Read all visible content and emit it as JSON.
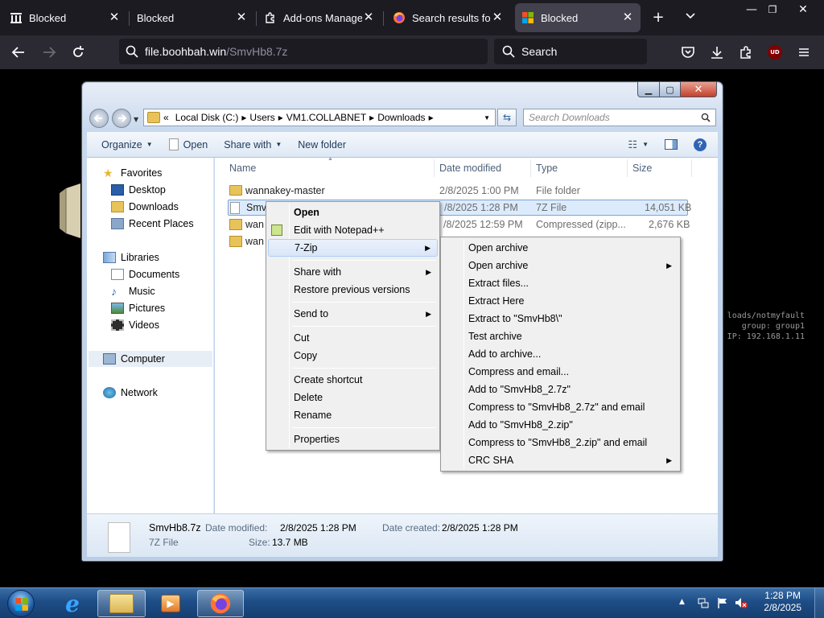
{
  "browser": {
    "tabs": [
      {
        "label": "Blocked",
        "icon": "pillar-icon",
        "active": false
      },
      {
        "label": "Blocked",
        "icon": "none",
        "active": false
      },
      {
        "label": "Add-ons Manager",
        "icon": "puzzle-icon",
        "active": false
      },
      {
        "label": "Search results for '",
        "icon": "firefox-icon",
        "active": false
      },
      {
        "label": "Blocked",
        "icon": "windows-logo-icon",
        "active": true
      }
    ],
    "url_host": "file.boohbah.win",
    "url_path": "/SmvHb8.7z",
    "search_placeholder": "Search",
    "ublock_badge": "UD"
  },
  "desktop_overlay": {
    "line1": "loads/notmyfault",
    "line2": "group: group1",
    "line3": "IP: 192.168.1.11"
  },
  "explorer": {
    "breadcrumb": [
      "«",
      "Local Disk (C:)",
      "Users",
      "VM1.COLLABNET",
      "Downloads"
    ],
    "search_placeholder": "Search Downloads",
    "toolbar": {
      "organize": "Organize",
      "open": "Open",
      "share_with": "Share with",
      "new_folder": "New folder"
    },
    "nav": {
      "favorites": "Favorites",
      "desktop": "Desktop",
      "downloads": "Downloads",
      "recent_places": "Recent Places",
      "libraries": "Libraries",
      "documents": "Documents",
      "music": "Music",
      "pictures": "Pictures",
      "videos": "Videos",
      "computer": "Computer",
      "network": "Network"
    },
    "columns": {
      "name": "Name",
      "date": "Date modified",
      "type": "Type",
      "size": "Size"
    },
    "files": [
      {
        "name": "wannakey-master",
        "date": "2/8/2025 1:00 PM",
        "type": "File folder",
        "size": ""
      },
      {
        "name": "Smv",
        "date": "/8/2025 1:28 PM",
        "type": "7Z File",
        "size": "14,051 KB"
      },
      {
        "name": "wan",
        "date": "/8/2025 12:59 PM",
        "type": "Compressed (zipp...",
        "size": "2,676 KB"
      },
      {
        "name": "wan",
        "date": "",
        "type": "",
        "size": ""
      }
    ],
    "details": {
      "filename": "SmvHb8.7z",
      "filetype": "7Z File",
      "date_modified_label": "Date modified:",
      "date_modified": "2/8/2025 1:28 PM",
      "date_created_label": "Date created:",
      "date_created": "2/8/2025 1:28 PM",
      "size_label": "Size:",
      "size": "13.7 MB"
    }
  },
  "context_menu": {
    "items": [
      "Open",
      "Edit with Notepad++",
      "7-Zip",
      "Share with",
      "Restore previous versions",
      "Send to",
      "Cut",
      "Copy",
      "Create shortcut",
      "Delete",
      "Rename",
      "Properties"
    ]
  },
  "submenu": {
    "items": [
      "Open archive",
      "Open archive",
      "Extract files...",
      "Extract Here",
      "Extract to \"SmvHb8\\\"",
      "Test archive",
      "Add to archive...",
      "Compress and email...",
      "Add to \"SmvHb8_2.7z\"",
      "Compress to \"SmvHb8_2.7z\" and email",
      "Add to \"SmvHb8_2.zip\"",
      "Compress to \"SmvHb8_2.zip\" and email",
      "CRC SHA"
    ]
  },
  "taskbar": {
    "time": "1:28 PM",
    "date": "2/8/2025"
  }
}
